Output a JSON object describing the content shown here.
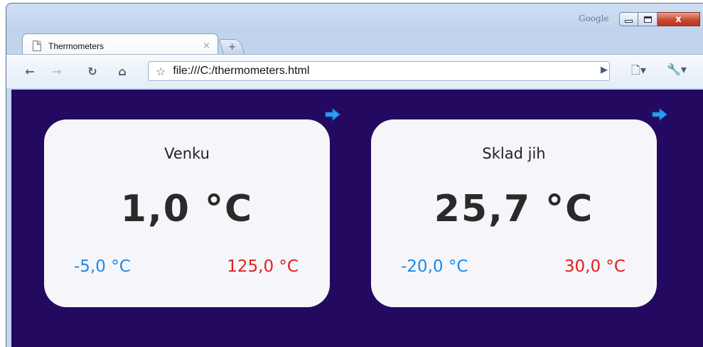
{
  "window": {
    "search_brand": "Google",
    "close_glyph": "x"
  },
  "tab": {
    "title": "Thermometers",
    "close_glyph": "×",
    "new_tab_glyph": "+"
  },
  "toolbar": {
    "url": "file:///C:/thermometers.html"
  },
  "thermometers": [
    {
      "name": "Venku",
      "current": "1,0 °C",
      "min": "-5,0 °C",
      "max": "125,0 °C"
    },
    {
      "name": "Sklad jih",
      "current": "25,7 °C",
      "min": "-20,0 °C",
      "max": "30,0 °C"
    }
  ],
  "colors": {
    "background": "#230a60",
    "card": "#f6f6fa",
    "min": "#1e88e5",
    "max": "#e02020",
    "arrow": "#2a9df4"
  },
  "icons": [
    "page-icon",
    "back-icon",
    "forward-icon",
    "reload-icon",
    "home-icon",
    "star-icon",
    "go-icon",
    "page-menu-icon",
    "wrench-icon",
    "arrow-right-icon"
  ]
}
